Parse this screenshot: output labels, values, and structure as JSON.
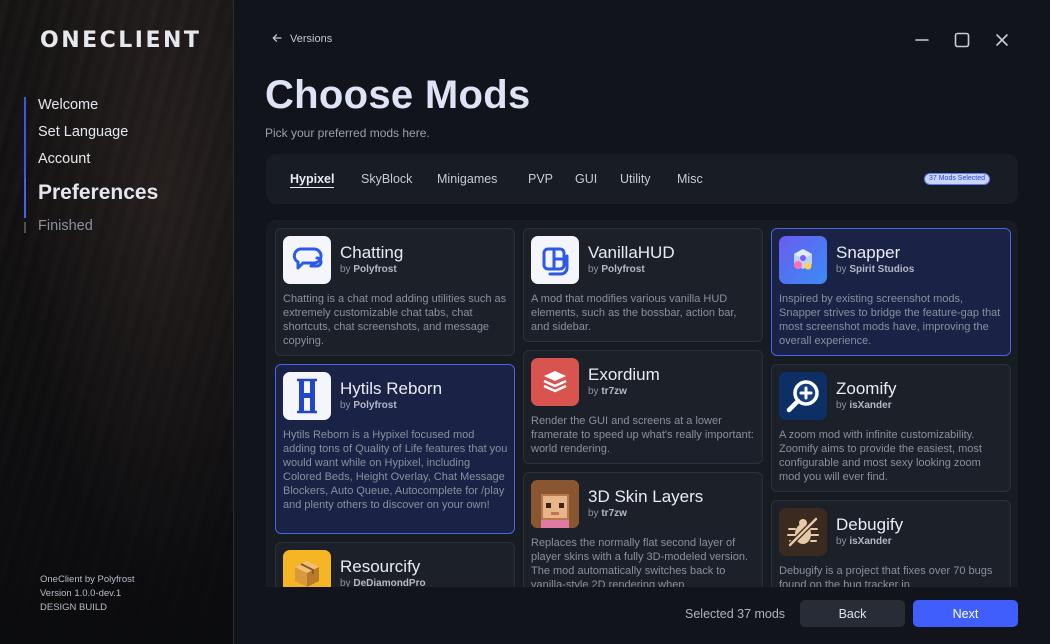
{
  "app": {
    "logo": "ONECLIENT"
  },
  "sidebar": {
    "steps": [
      {
        "label": "Welcome",
        "state": "done"
      },
      {
        "label": "Set Language",
        "state": "done"
      },
      {
        "label": "Account",
        "state": "done"
      },
      {
        "label": "Preferences",
        "state": "active"
      },
      {
        "label": "Finished",
        "state": "todo"
      }
    ],
    "footer": {
      "line1": "OneClient by Polyfrost",
      "line2": "Version 1.0.0-dev.1",
      "line3": "DESIGN BUILD"
    }
  },
  "header": {
    "back_label": "Versions",
    "title": "Choose Mods",
    "subtitle": "Pick your preferred mods here."
  },
  "tabs": {
    "items": [
      "Hypixel",
      "SkyBlock",
      "Minigames",
      "PVP",
      "GUI",
      "Utility",
      "Misc"
    ],
    "active": "Hypixel",
    "badge": "37 Mods Selected"
  },
  "mods": [
    {
      "name": "Chatting",
      "by": "by",
      "author": "Polyfrost",
      "selected": false,
      "icon": "chatting-icon",
      "desc": "Chatting is a chat mod adding utilities such as extremely customizable chat tabs, chat shortcuts, chat screenshots, and message copying."
    },
    {
      "name": "Hytils Reborn",
      "by": "by",
      "author": "Polyfrost",
      "selected": true,
      "icon": "hytils-icon",
      "desc": "Hytils Reborn is a Hypixel focused mod adding tons of Quality of Life features that you would want while on Hypixel, including Colored Beds, Height Overlay, Chat Message Blockers, Auto Queue, Autocomplete for /play and plenty others to discover on your own!"
    },
    {
      "name": "Resourcify",
      "by": "by",
      "author": "DeDiamondPro",
      "selected": false,
      "icon": "resourcify-icon",
      "desc": ""
    },
    {
      "name": "VanillaHUD",
      "by": "by",
      "author": "Polyfrost",
      "selected": false,
      "icon": "vanillahud-icon",
      "desc": "A mod that modifies various vanilla HUD elements, such as the bossbar, action bar, and sidebar."
    },
    {
      "name": "Exordium",
      "by": "by",
      "author": "tr7zw",
      "selected": false,
      "icon": "exordium-icon",
      "desc": "Render the GUI and screens at a lower framerate to speed up what's really important: world rendering."
    },
    {
      "name": "3D Skin Layers",
      "by": "by",
      "author": "tr7zw",
      "selected": false,
      "icon": "skin-layers-icon",
      "desc": "Replaces the normally flat second layer of player skins with a fully 3D-modeled version. The mod automatically switches back to vanilla-style 2D rendering when"
    },
    {
      "name": "Snapper",
      "by": "by",
      "author": "Spirit Studios",
      "selected": true,
      "icon": "snapper-icon",
      "desc": "Inspired by existing screenshot mods, Snapper strives to bridge the feature-gap that most screenshot mods have, improving the overall experience."
    },
    {
      "name": "Zoomify",
      "by": "by",
      "author": "isXander",
      "selected": false,
      "icon": "zoomify-icon",
      "desc": "A zoom mod with infinite customizability. Zoomify aims to provide the easiest, most configurable and most sexy looking zoom mod you will ever find."
    },
    {
      "name": "Debugify",
      "by": "by",
      "author": "isXander",
      "selected": false,
      "icon": "debugify-icon",
      "desc": "Debugify is a project that fixes over 70 bugs found on the bug tracker in"
    }
  ],
  "footer": {
    "selected_text": "Selected 37 mods",
    "back_label": "Back",
    "next_label": "Next"
  },
  "colors": {
    "accent": "#3f5efb",
    "selected_card_bg": "#1a2246",
    "selected_card_border": "#4863e6"
  }
}
